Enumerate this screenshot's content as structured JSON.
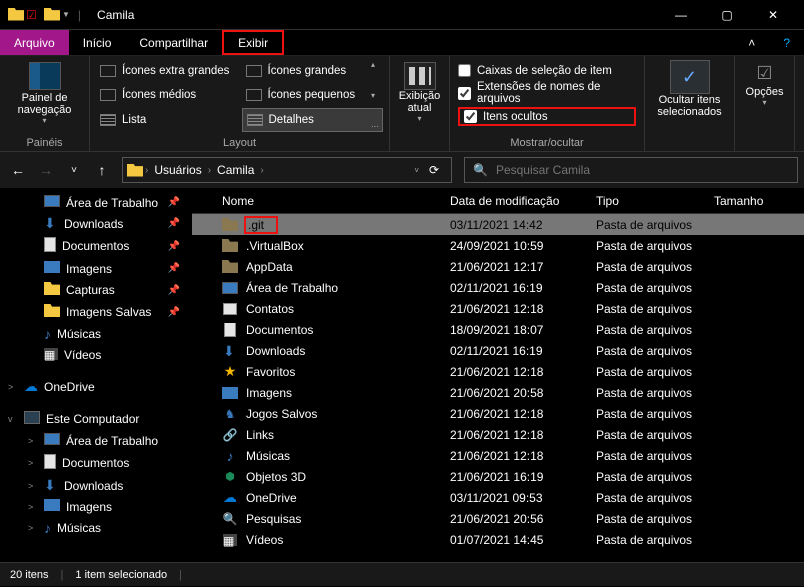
{
  "window": {
    "title": "Camila"
  },
  "menubar": {
    "arquivo": "Arquivo",
    "inicio": "Início",
    "compartilhar": "Compartilhar",
    "exibir": "Exibir"
  },
  "ribbon": {
    "paineis": {
      "label": "Painel de navegação",
      "group": "Painéis"
    },
    "layout": {
      "group": "Layout",
      "items": [
        "Ícones extra grandes",
        "Ícones grandes",
        "Ícones médios",
        "Ícones pequenos",
        "Lista",
        "Detalhes"
      ]
    },
    "current_view": {
      "label": "Exibição atual"
    },
    "show_hide": {
      "group": "Mostrar/ocultar",
      "cb1": "Caixas de seleção de item",
      "cb2": "Extensões de nomes de arquivos",
      "cb3": "Itens ocultos"
    },
    "ocultar": {
      "label": "Ocultar itens selecionados"
    },
    "opcoes": "Opções"
  },
  "breadcrumb": {
    "c1": "Usuários",
    "c2": "Camila"
  },
  "search": {
    "placeholder": "Pesquisar Camila"
  },
  "sidebar": {
    "items": [
      {
        "label": "Área de Trabalho",
        "icon": "desktop",
        "pin": true,
        "child": true
      },
      {
        "label": "Downloads",
        "icon": "download",
        "pin": true,
        "child": true
      },
      {
        "label": "Documentos",
        "icon": "doc",
        "pin": true,
        "child": true
      },
      {
        "label": "Imagens",
        "icon": "img",
        "pin": true,
        "child": true
      },
      {
        "label": "Capturas",
        "icon": "folder",
        "pin": true,
        "child": true
      },
      {
        "label": "Imagens Salvas",
        "icon": "folder",
        "pin": true,
        "child": true
      },
      {
        "label": "Músicas",
        "icon": "music",
        "child": true
      },
      {
        "label": "Vídeos",
        "icon": "video",
        "child": true
      },
      {
        "label": "OneDrive",
        "icon": "cloud",
        "exp": ">",
        "top": true
      },
      {
        "label": "Este Computador",
        "icon": "pc",
        "exp": "v",
        "top": true
      },
      {
        "label": "Área de Trabalho",
        "icon": "desktop",
        "child": true,
        "exp": ">"
      },
      {
        "label": "Documentos",
        "icon": "doc",
        "child": true,
        "exp": ">"
      },
      {
        "label": "Downloads",
        "icon": "download",
        "child": true,
        "exp": ">"
      },
      {
        "label": "Imagens",
        "icon": "img",
        "child": true,
        "exp": ">"
      },
      {
        "label": "Músicas",
        "icon": "music",
        "child": true,
        "exp": ">"
      }
    ]
  },
  "columns": {
    "name": "Nome",
    "date": "Data de modificação",
    "type": "Tipo",
    "size": "Tamanho"
  },
  "rows": [
    {
      "name": ".git",
      "date": "03/11/2021 14:42",
      "type": "Pasta de arquivos",
      "icon": "folder-dark",
      "selected": true,
      "highlight": true
    },
    {
      "name": ".VirtualBox",
      "date": "24/09/2021 10:59",
      "type": "Pasta de arquivos",
      "icon": "folder-dark"
    },
    {
      "name": "AppData",
      "date": "21/06/2021 12:17",
      "type": "Pasta de arquivos",
      "icon": "folder-dark"
    },
    {
      "name": "Área de Trabalho",
      "date": "02/11/2021 16:19",
      "type": "Pasta de arquivos",
      "icon": "desktop"
    },
    {
      "name": "Contatos",
      "date": "21/06/2021 12:18",
      "type": "Pasta de arquivos",
      "icon": "contact"
    },
    {
      "name": "Documentos",
      "date": "18/09/2021 18:07",
      "type": "Pasta de arquivos",
      "icon": "doc"
    },
    {
      "name": "Downloads",
      "date": "02/11/2021 16:19",
      "type": "Pasta de arquivos",
      "icon": "download"
    },
    {
      "name": "Favoritos",
      "date": "21/06/2021 12:18",
      "type": "Pasta de arquivos",
      "icon": "star"
    },
    {
      "name": "Imagens",
      "date": "21/06/2021 20:58",
      "type": "Pasta de arquivos",
      "icon": "img"
    },
    {
      "name": "Jogos Salvos",
      "date": "21/06/2021 12:18",
      "type": "Pasta de arquivos",
      "icon": "game"
    },
    {
      "name": "Links",
      "date": "21/06/2021 12:18",
      "type": "Pasta de arquivos",
      "icon": "link"
    },
    {
      "name": "Músicas",
      "date": "21/06/2021 12:18",
      "type": "Pasta de arquivos",
      "icon": "music"
    },
    {
      "name": "Objetos 3D",
      "date": "21/06/2021 16:19",
      "type": "Pasta de arquivos",
      "icon": "cube"
    },
    {
      "name": "OneDrive",
      "date": "03/11/2021 09:53",
      "type": "Pasta de arquivos",
      "icon": "cloud"
    },
    {
      "name": "Pesquisas",
      "date": "21/06/2021 20:56",
      "type": "Pasta de arquivos",
      "icon": "search"
    },
    {
      "name": "Vídeos",
      "date": "01/07/2021 14:45",
      "type": "Pasta de arquivos",
      "icon": "video"
    }
  ],
  "status": {
    "count": "20 itens",
    "selected": "1 item selecionado"
  }
}
